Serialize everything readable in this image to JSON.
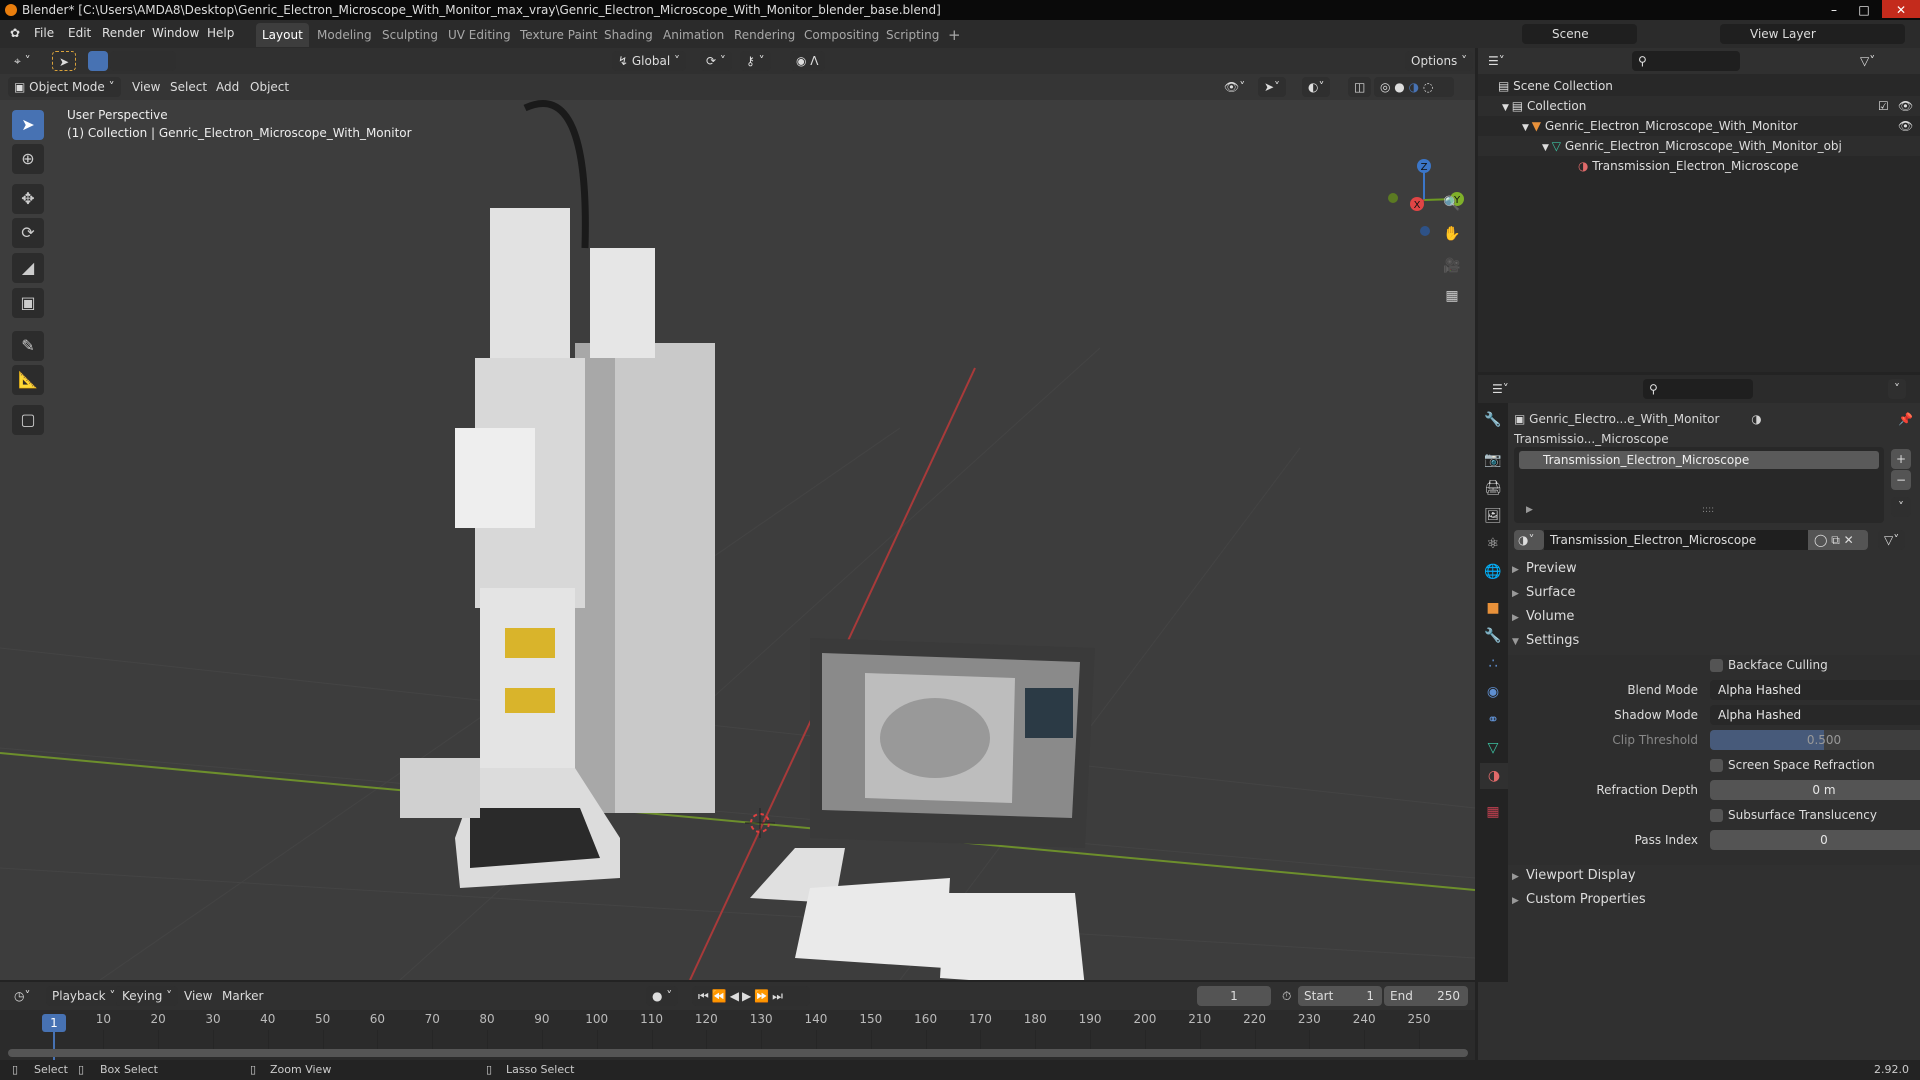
{
  "window": {
    "title": "Blender* [C:\\Users\\AMDA8\\Desktop\\Genric_Electron_Microscope_With_Monitor_max_vray\\Genric_Electron_Microscope_With_Monitor_blender_base.blend]"
  },
  "menu": [
    "File",
    "Edit",
    "Render",
    "Window",
    "Help"
  ],
  "workspaces": [
    "Layout",
    "Modeling",
    "Sculpting",
    "UV Editing",
    "Texture Paint",
    "Shading",
    "Animation",
    "Rendering",
    "Compositing",
    "Scripting",
    "+"
  ],
  "viewport": {
    "transform_orientation": "Global",
    "options_label": "Options",
    "mode": "Object Mode",
    "menus": [
      "View",
      "Select",
      "Add",
      "Object"
    ],
    "overlay_title": "User Perspective",
    "overlay_subtitle": "(1) Collection | Genric_Electron_Microscope_With_Monitor",
    "gizmo": {
      "x": "X",
      "y": "Y",
      "z": "Z"
    }
  },
  "outliner": {
    "scene": "Scene",
    "view_layer": "View Layer",
    "items": [
      {
        "label": "Scene Collection"
      },
      {
        "label": "Collection"
      },
      {
        "label": "Genric_Electron_Microscope_With_Monitor"
      },
      {
        "label": "Genric_Electron_Microscope_With_Monitor_obj"
      },
      {
        "label": "Transmission_Electron_Microscope"
      }
    ]
  },
  "properties": {
    "breadcrumb_object": "Genric_Electro...e_With_Monitor",
    "breadcrumb_material": "Transmissio..._Microscope",
    "slot": "Transmission_Electron_Microscope",
    "material_name": "Transmission_Electron_Microscope",
    "panels": {
      "preview": "Preview",
      "surface": "Surface",
      "volume": "Volume",
      "settings": "Settings",
      "viewport_display": "Viewport Display",
      "custom_properties": "Custom Properties"
    },
    "settings": {
      "backface_culling": {
        "label": "Backface Culling",
        "checked": false
      },
      "blend_mode": {
        "label": "Blend Mode",
        "value": "Alpha Hashed"
      },
      "shadow_mode": {
        "label": "Shadow Mode",
        "value": "Alpha Hashed"
      },
      "clip_threshold": {
        "label": "Clip Threshold",
        "value": "0.500",
        "fraction": 0.5
      },
      "ssr": {
        "label": "Screen Space Refraction",
        "checked": false
      },
      "refraction_depth": {
        "label": "Refraction Depth",
        "value": "0 m"
      },
      "subsurface": {
        "label": "Subsurface Translucency",
        "checked": false
      },
      "pass_index": {
        "label": "Pass Index",
        "value": "0"
      }
    }
  },
  "timeline": {
    "menus": [
      "Playback",
      "Keying",
      "View",
      "Marker"
    ],
    "current_frame": "1",
    "start_label": "Start",
    "start": "1",
    "end_label": "End",
    "end": "250",
    "ticks": [
      "10",
      "20",
      "30",
      "40",
      "50",
      "60",
      "70",
      "80",
      "90",
      "100",
      "110",
      "120",
      "130",
      "140",
      "150",
      "160",
      "170",
      "180",
      "190",
      "200",
      "210",
      "220",
      "230",
      "240",
      "250"
    ]
  },
  "status": {
    "select": "Select",
    "box_select": "Box Select",
    "zoom_view": "Zoom View",
    "lasso_select": "Lasso Select",
    "version": "2.92.0"
  },
  "colors": {
    "accent": "#4772b3",
    "x_axis": "#a83a3a",
    "y_axis": "#6d8f2c",
    "viewport_bg": "#3d3d3d"
  }
}
